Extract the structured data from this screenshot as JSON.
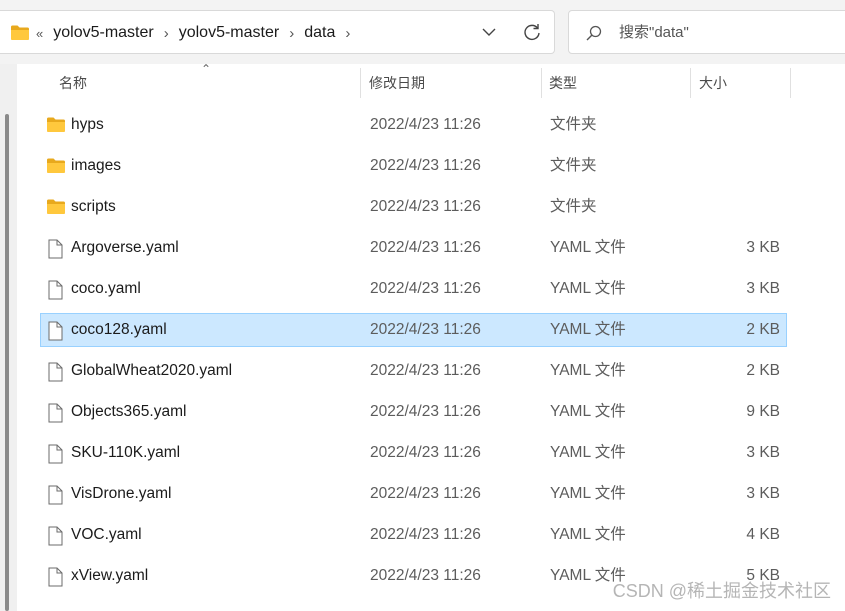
{
  "address_bar": {
    "overflow": "«",
    "breadcrumbs": [
      "yolov5-master",
      "yolov5-master",
      "data"
    ]
  },
  "search": {
    "placeholder": "搜索\"data\""
  },
  "columns": {
    "name": "名称",
    "modified": "修改日期",
    "type": "类型",
    "size": "大小"
  },
  "files": [
    {
      "name": "hyps",
      "modified": "2022/4/23 11:26",
      "type": "文件夹",
      "size": "",
      "kind": "folder",
      "selected": false
    },
    {
      "name": "images",
      "modified": "2022/4/23 11:26",
      "type": "文件夹",
      "size": "",
      "kind": "folder",
      "selected": false
    },
    {
      "name": "scripts",
      "modified": "2022/4/23 11:26",
      "type": "文件夹",
      "size": "",
      "kind": "folder",
      "selected": false
    },
    {
      "name": "Argoverse.yaml",
      "modified": "2022/4/23 11:26",
      "type": "YAML 文件",
      "size": "3 KB",
      "kind": "file",
      "selected": false
    },
    {
      "name": "coco.yaml",
      "modified": "2022/4/23 11:26",
      "type": "YAML 文件",
      "size": "3 KB",
      "kind": "file",
      "selected": false
    },
    {
      "name": "coco128.yaml",
      "modified": "2022/4/23 11:26",
      "type": "YAML 文件",
      "size": "2 KB",
      "kind": "file",
      "selected": true
    },
    {
      "name": "GlobalWheat2020.yaml",
      "modified": "2022/4/23 11:26",
      "type": "YAML 文件",
      "size": "2 KB",
      "kind": "file",
      "selected": false
    },
    {
      "name": "Objects365.yaml",
      "modified": "2022/4/23 11:26",
      "type": "YAML 文件",
      "size": "9 KB",
      "kind": "file",
      "selected": false
    },
    {
      "name": "SKU-110K.yaml",
      "modified": "2022/4/23 11:26",
      "type": "YAML 文件",
      "size": "3 KB",
      "kind": "file",
      "selected": false
    },
    {
      "name": "VisDrone.yaml",
      "modified": "2022/4/23 11:26",
      "type": "YAML 文件",
      "size": "3 KB",
      "kind": "file",
      "selected": false
    },
    {
      "name": "VOC.yaml",
      "modified": "2022/4/23 11:26",
      "type": "YAML 文件",
      "size": "4 KB",
      "kind": "file",
      "selected": false
    },
    {
      "name": "xView.yaml",
      "modified": "2022/4/23 11:26",
      "type": "YAML 文件",
      "size": "5 KB",
      "kind": "file",
      "selected": false
    }
  ],
  "watermark": "CSDN @稀土掘金技术社区",
  "colors": {
    "folder": "#ffc83d",
    "selection_bg": "#cce8ff",
    "selection_border": "#99d1ff"
  },
  "icons": {
    "folder": "folder-icon",
    "file": "file-icon",
    "search": "search-icon",
    "refresh": "refresh-icon",
    "dropdown": "chevron-down-icon"
  }
}
